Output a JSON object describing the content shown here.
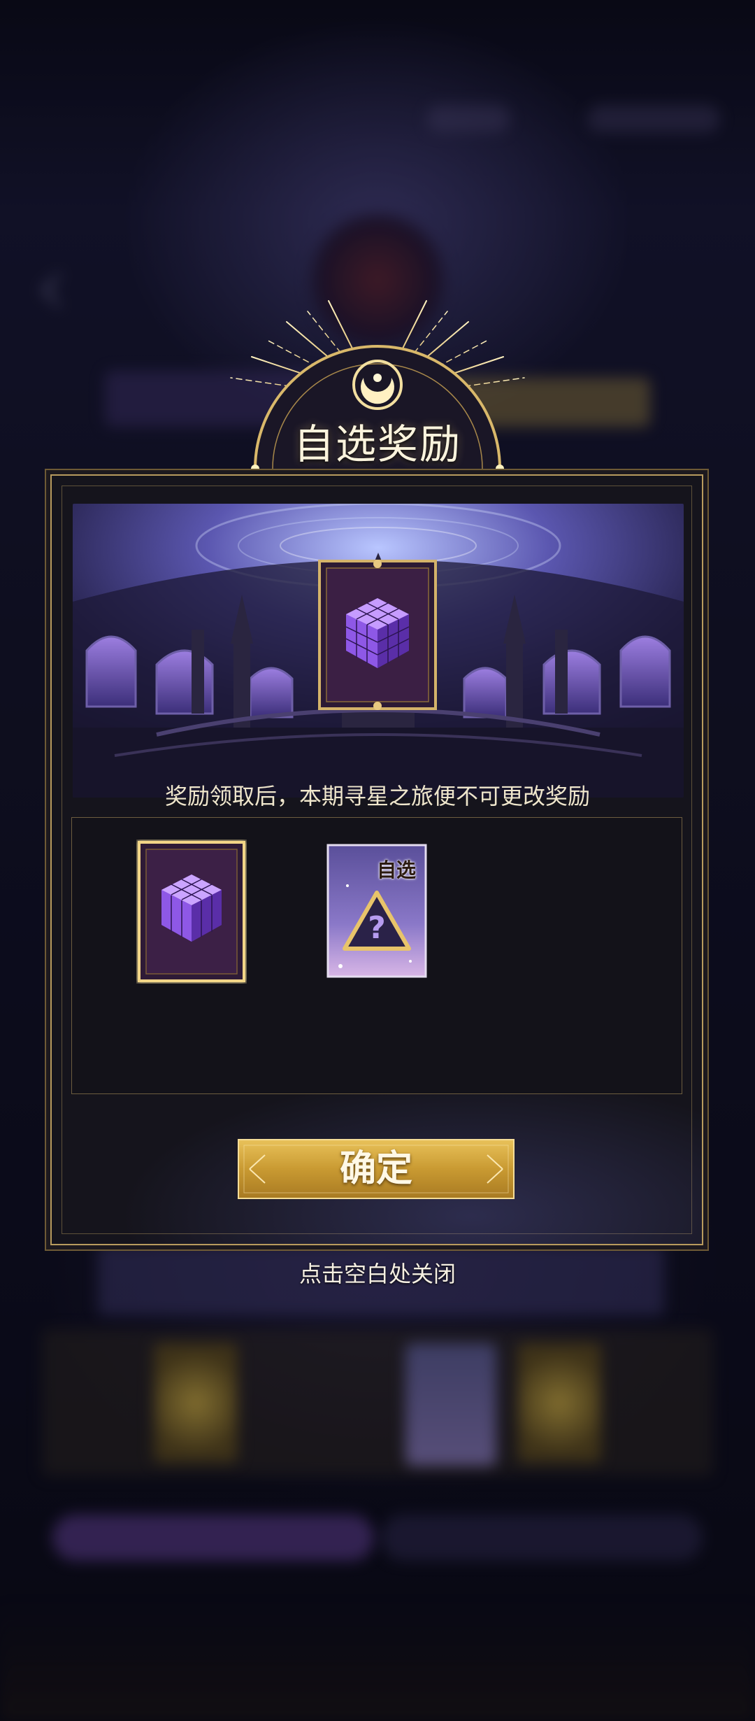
{
  "dialog": {
    "title": "自选奖励",
    "notice": "奖励领取后，本期寻星之旅便不可更改奖励",
    "confirm_label": "确定",
    "close_hint": "点击空白处关闭"
  },
  "items": [
    {
      "icon": "purple-cube-card-icon",
      "selected": true
    },
    {
      "icon": "optional-reward-card-icon",
      "label": "自选",
      "selected": false
    }
  ],
  "colors": {
    "gold": "#b89b5e",
    "panel": "#15141c",
    "button_gold": "#c9a33c",
    "cube_purple": "#8a5ce0"
  }
}
